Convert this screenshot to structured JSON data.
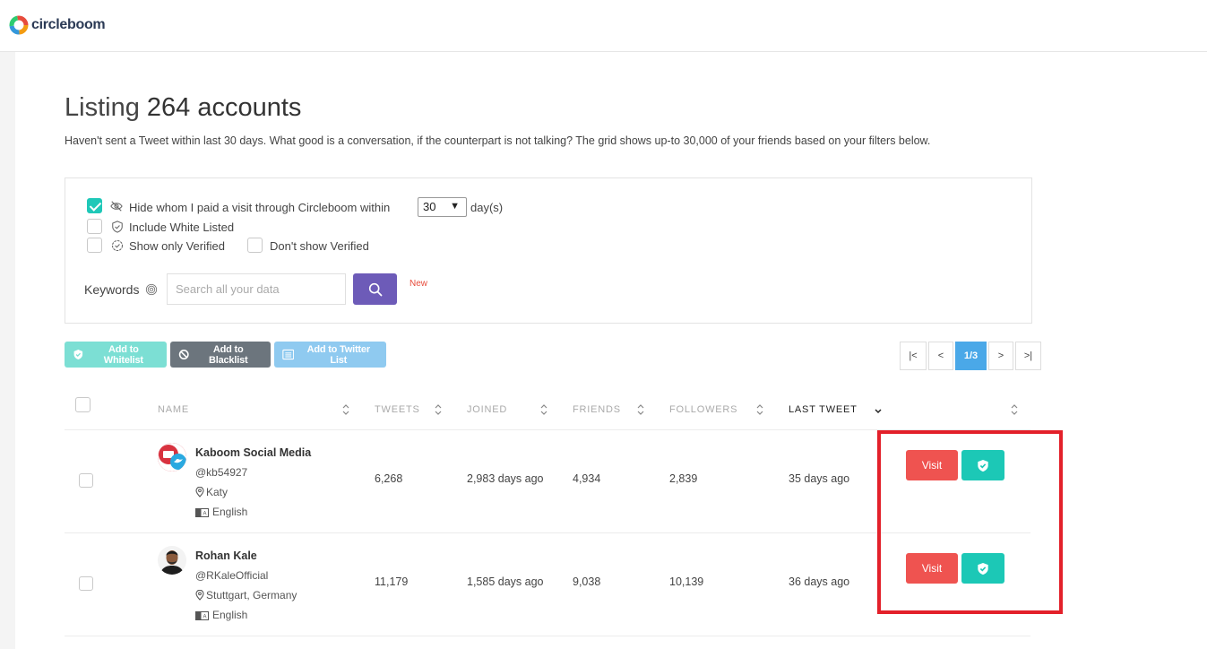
{
  "brand": {
    "name": "circleboom"
  },
  "page": {
    "title_prefix": "Listing",
    "title_count": "264 accounts",
    "subtitle": "Haven't sent a Tweet within last 30 days. What good is a conversation, if the counterpart is not talking? The grid shows up-to 30,000 of your friends based on your filters below."
  },
  "filters": {
    "hide_visited_label": "Hide whom I paid a visit through Circleboom within",
    "hide_visited_checked": true,
    "days_value": "30",
    "days_unit": "day(s)",
    "include_whitelisted_label": "Include White Listed",
    "show_only_verified_label": "Show only Verified",
    "dont_show_verified_label": "Don't show Verified",
    "keywords_label": "Keywords",
    "search_placeholder": "Search all your data",
    "new_badge": "New"
  },
  "actions": {
    "whitelist": "Add to Whitelist",
    "blacklist": "Add to Blacklist",
    "twitter_list": "Add to Twitter List"
  },
  "pagination": {
    "first": "|<",
    "prev": "<",
    "current": "1/3",
    "next": ">",
    "last": ">|"
  },
  "table": {
    "headers": {
      "name": "NAME",
      "tweets": "TWEETS",
      "joined": "JOINED",
      "friends": "FRIENDS",
      "followers": "FOLLOWERS",
      "last_tweet": "LAST TWEET"
    },
    "rows": [
      {
        "name": "Kaboom Social Media",
        "handle": "@kb54927",
        "location": "Katy",
        "language": "English",
        "tweets": "6,268",
        "joined": "2,983 days ago",
        "friends": "4,934",
        "followers": "2,839",
        "last_tweet": "35 days ago",
        "visit_label": "Visit"
      },
      {
        "name": "Rohan Kale",
        "handle": "@RKaleOfficial",
        "location": "Stuttgart, Germany",
        "language": "English",
        "tweets": "11,179",
        "joined": "1,585 days ago",
        "friends": "9,038",
        "followers": "10,139",
        "last_tweet": "36 days ago",
        "visit_label": "Visit"
      }
    ]
  },
  "colors": {
    "accent_teal": "#1cc8b6",
    "visit_red": "#ef5350",
    "search_purple": "#6d5bb8",
    "highlight_red": "#e3202a"
  }
}
